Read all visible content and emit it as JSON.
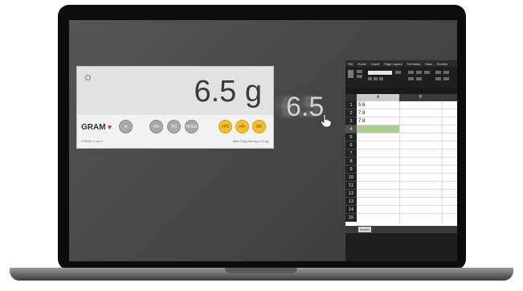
{
  "scale_app": {
    "weight": "6.5 g",
    "brand": "GRAM",
    "buttons": [
      {
        "label": "",
        "kind": "gray"
      },
      {
        "label": ">0<",
        "kind": "gray"
      },
      {
        "label": "T/0",
        "kind": "gray"
      },
      {
        "label": "HOLD",
        "kind": "gray"
      },
      {
        "label": ">PC",
        "kind": "yellow"
      },
      {
        "label": ">0<",
        "kind": "yellow"
      },
      {
        "label": "0/0",
        "kind": "yellow"
      }
    ],
    "status_left": "ZYBOX-1  ver.0",
    "status_right": "Max:200g  Min:0g  e=0.1g"
  },
  "floating_value": "6.5",
  "excel": {
    "tabs": [
      "File",
      "Home",
      "Insert",
      "Page Layout",
      "Formulas",
      "Data",
      "Review"
    ],
    "columns": [
      "A",
      "B"
    ],
    "rows": [
      "1",
      "2",
      "3",
      "4",
      "5",
      "6",
      "7",
      "8",
      "9",
      "10",
      "11",
      "12",
      "13",
      "14",
      "15"
    ],
    "cells": [
      {
        "row": "1",
        "value": "5.6"
      },
      {
        "row": "2",
        "value": "7.9"
      },
      {
        "row": "3",
        "value": "7.8"
      }
    ],
    "active_row": "4",
    "sheet_tab": "Sheet1",
    "colors": {
      "selected_cell": "#a8cf8e"
    }
  },
  "colors": {
    "scale_yellow": "#f3bf2f",
    "scale_gray": "#a9a9a9",
    "brand_red": "#d81e1e"
  }
}
